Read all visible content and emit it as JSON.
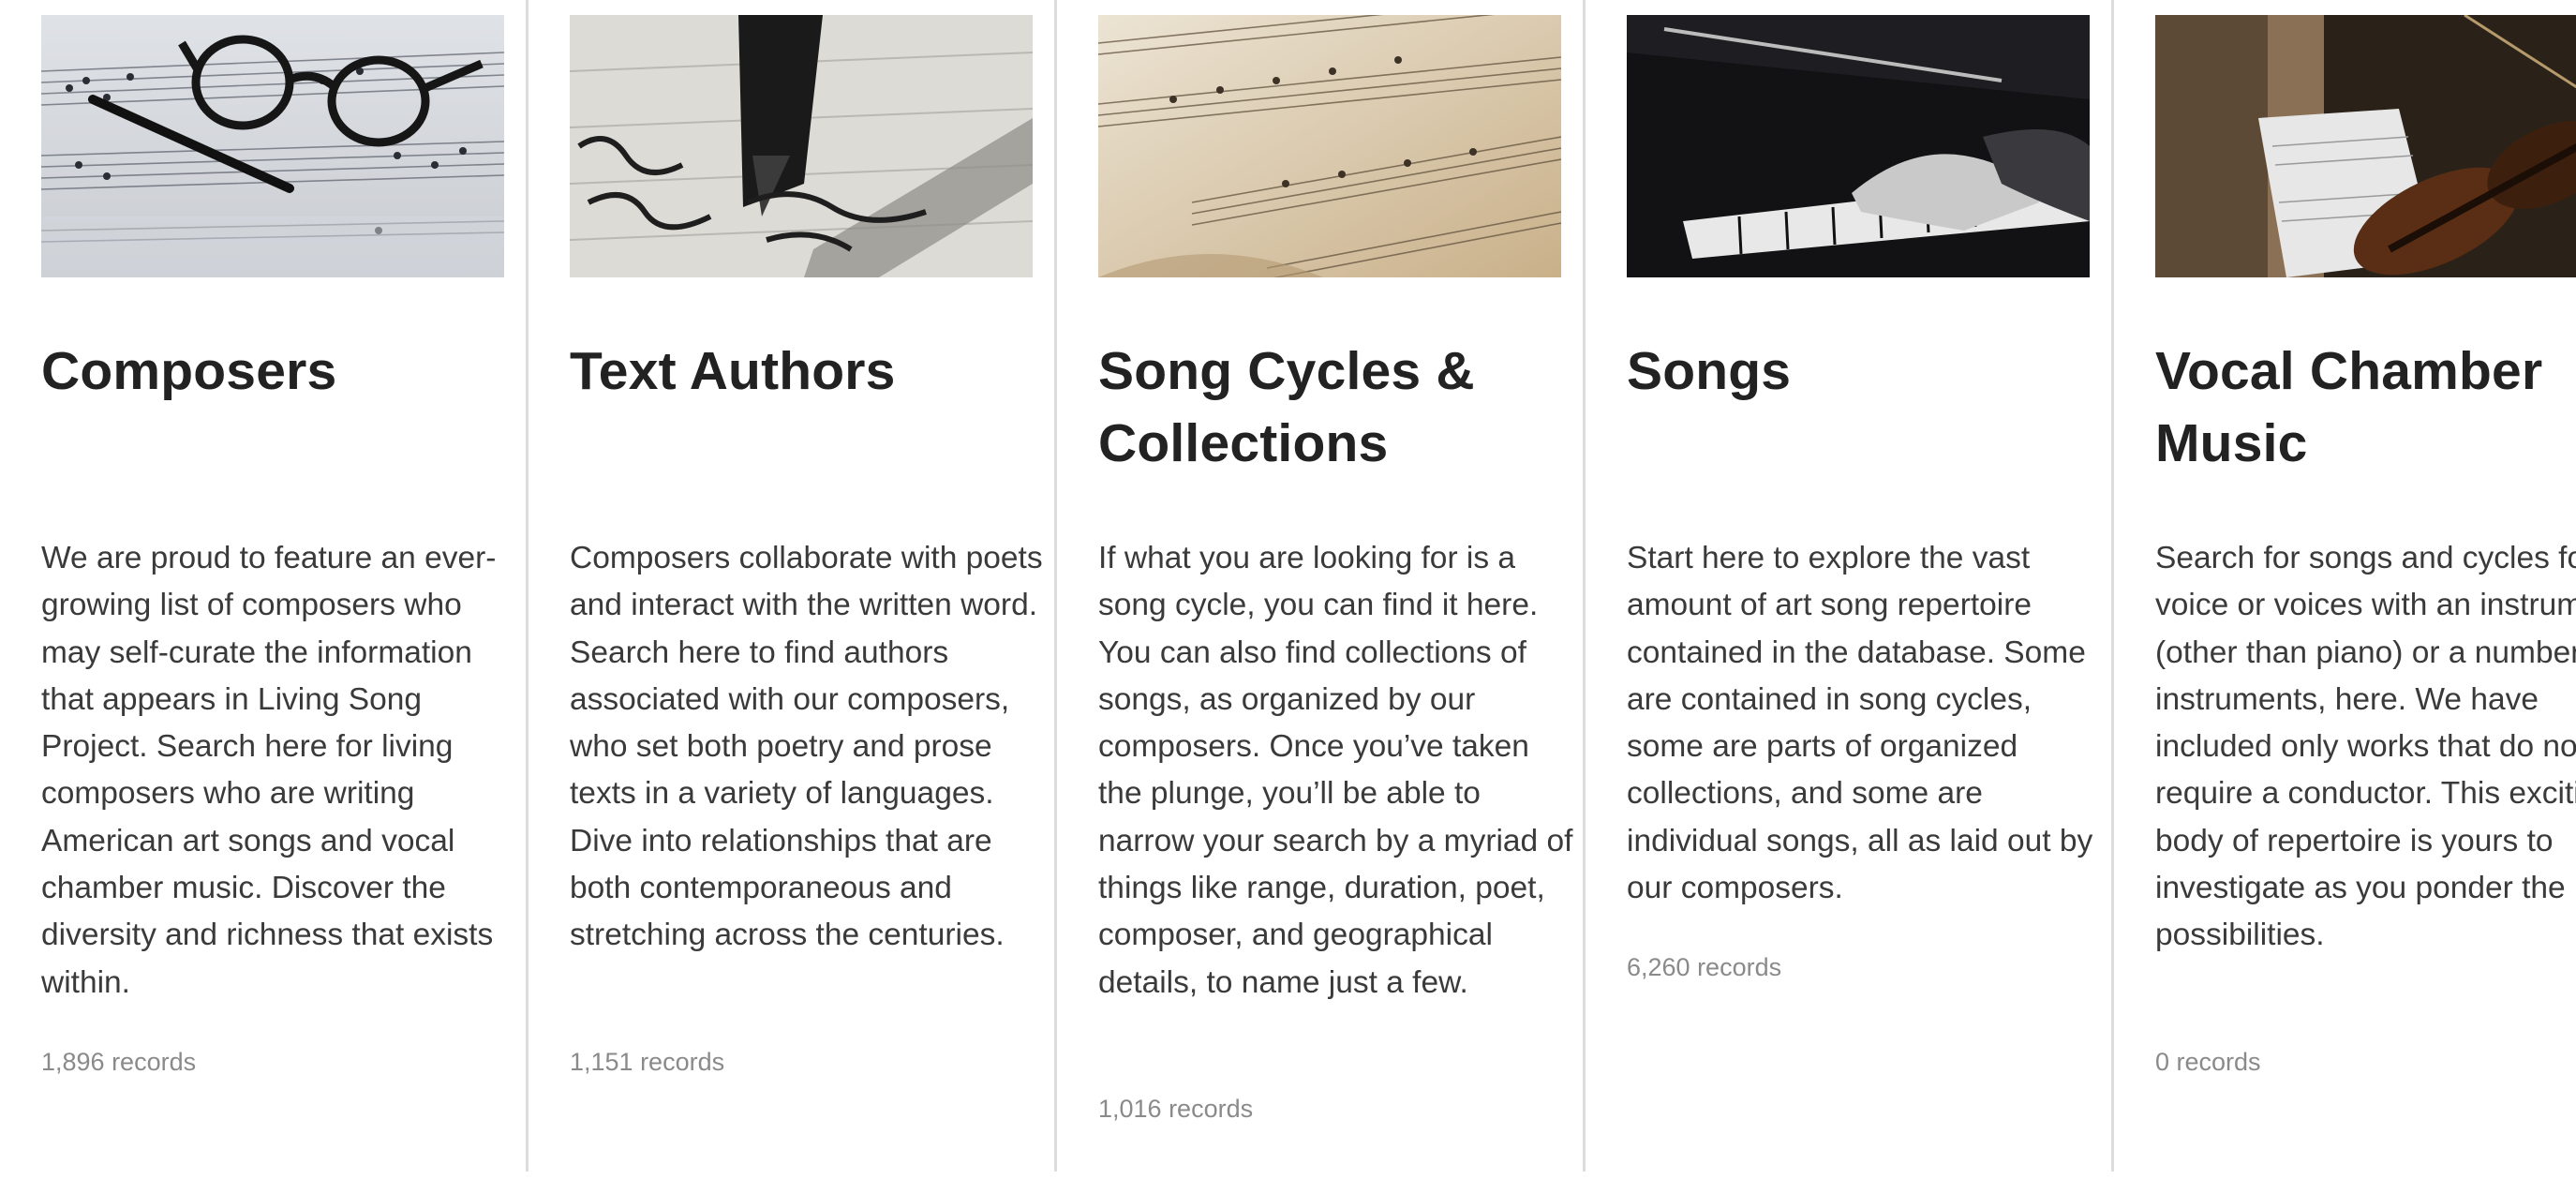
{
  "categories": [
    {
      "title": "Composers",
      "description": "We are proud to feature an ever-growing list of composers who may self-curate the information that appears in Living Song Project. Search here for living composers who are writing American art songs and vocal chamber music. Discover the diversity and richness that exists within.",
      "count": "1,896 records",
      "image_icon": "glasses-and-pen-on-sheet-music"
    },
    {
      "title": "Text Authors",
      "description": "Composers collaborate with poets and interact with the written word. Search here to find authors associated with our composers, who set both poetry and prose texts in a variety of languages. Dive into relationships that are both contemporaneous and stretching across the centuries.",
      "count": "1,151 records",
      "image_icon": "fountain-pen-writing"
    },
    {
      "title": "Song Cycles & Collections",
      "description": "If what you are looking for is a song cycle, you can find it here. You can also find collections of songs, as organized by our composers. Once you’ve taken the plunge, you’ll be able to narrow your search by a myriad of things like range, duration, poet, composer, and geographical details, to name just a few.",
      "count": "1,016 records",
      "image_icon": "open-music-book"
    },
    {
      "title": "Songs",
      "description": "Start here to explore the vast amount of art song repertoire contained in the database. Some are contained in song cycles, some are parts of organized collections, and some are individual songs, all as laid out by our composers.",
      "count": "6,260 records",
      "image_icon": "hands-on-piano"
    },
    {
      "title": "Vocal Chamber Music",
      "description": "Search for songs and cycles for voice or voices with an instrument (other than piano) or a number of instruments, here. We have included only works that do not require a conductor. This exciting body of repertoire is yours to investigate as you ponder the possibilities.",
      "count": "0 records",
      "image_icon": "violin-and-sheet-music"
    }
  ]
}
